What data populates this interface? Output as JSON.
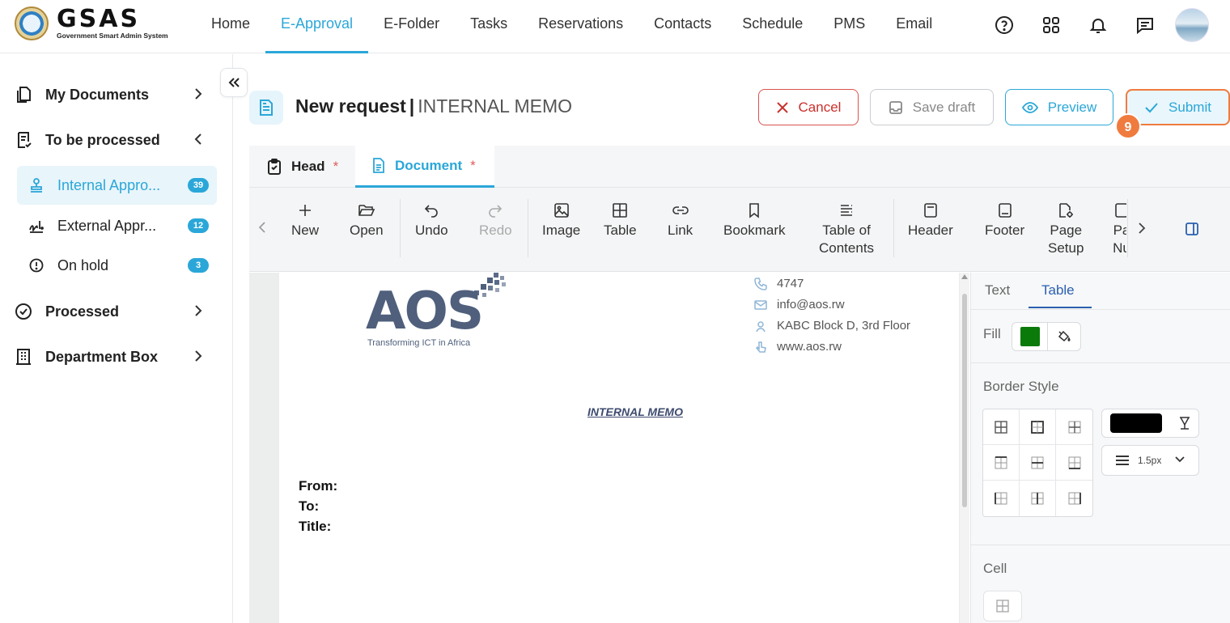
{
  "app": {
    "logo_title": "GSAS",
    "logo_subtitle": "Government Smart Admin System"
  },
  "nav": {
    "items": [
      {
        "label": "Home"
      },
      {
        "label": "E-Approval",
        "active": true
      },
      {
        "label": "E-Folder"
      },
      {
        "label": "Tasks"
      },
      {
        "label": "Reservations"
      },
      {
        "label": "Contacts"
      },
      {
        "label": "Schedule"
      },
      {
        "label": "PMS"
      },
      {
        "label": "Email"
      }
    ],
    "icons": [
      "help-icon",
      "apps-grid-icon",
      "bell-icon",
      "chat-icon"
    ]
  },
  "sidebar": {
    "my_documents": "My Documents",
    "to_be_processed": "To be processed",
    "internal_approval": {
      "label": "Internal Appro...",
      "count": "39"
    },
    "external_approval": {
      "label": "External Appr...",
      "count": "12"
    },
    "on_hold": {
      "label": "On hold",
      "count": "3"
    },
    "processed": "Processed",
    "department_box": "Department Box"
  },
  "header": {
    "title": "New request",
    "separator": "|",
    "subtitle": "INTERNAL MEMO",
    "cancel": "Cancel",
    "save_draft": "Save draft",
    "preview": "Preview",
    "submit": "Submit",
    "step_marker": "9"
  },
  "tabs": {
    "head": "Head",
    "document": "Document",
    "required_mark": "*"
  },
  "toolbar": {
    "new": "New",
    "open": "Open",
    "undo": "Undo",
    "redo": "Redo",
    "image": "Image",
    "table": "Table",
    "link": "Link",
    "bookmark": "Bookmark",
    "toc_line1": "Table of",
    "toc_line2": "Contents",
    "header": "Header",
    "footer": "Footer",
    "page_setup_line1": "Page",
    "page_setup_line2": "Setup",
    "page_numbers_line1": "Pa",
    "page_numbers_line2": "Nu"
  },
  "document": {
    "company_logo": "AOS",
    "tagline": "Transforming ICT in Africa",
    "phone": "4747",
    "email": "info@aos.rw",
    "address": "KABC Block D, 3rd Floor",
    "website": "www.aos.rw",
    "memo_title": "INTERNAL MEMO",
    "from_label": "From:",
    "to_label": "To:",
    "title_label": "Title:"
  },
  "panel": {
    "tab_text": "Text",
    "tab_table": "Table",
    "fill_label": "Fill",
    "fill_color": "#0a7a0a",
    "border_style_label": "Border Style",
    "border_color": "#000000",
    "border_width": "1.5px",
    "cell_label": "Cell"
  },
  "colors": {
    "accent": "#2aa7d8",
    "danger": "#c9302c",
    "highlight": "#f07b3f"
  }
}
